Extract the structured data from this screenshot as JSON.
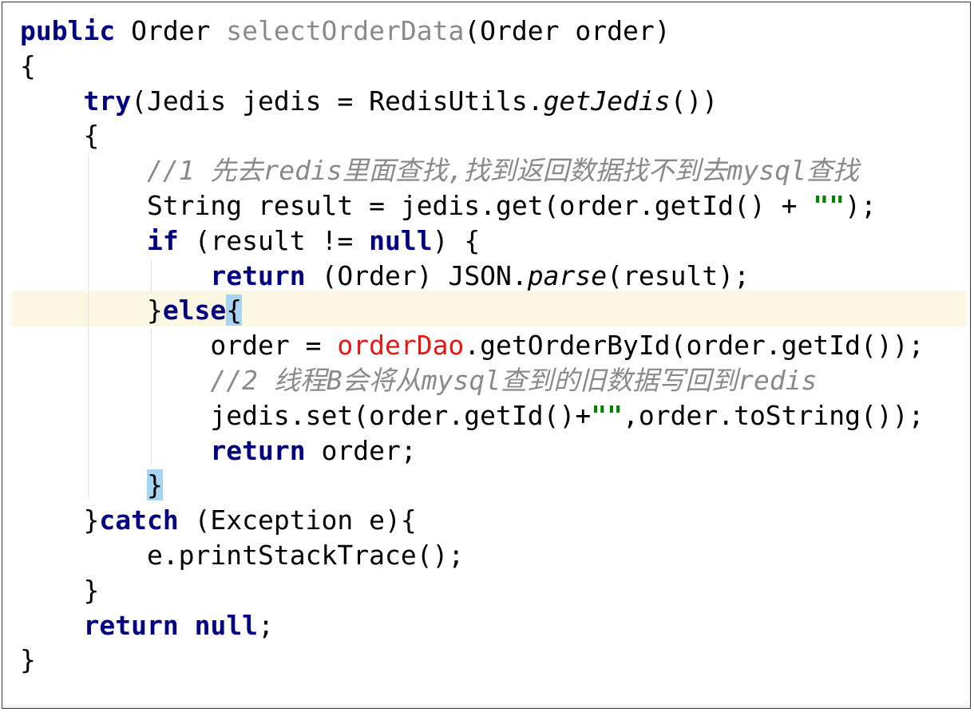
{
  "editor": {
    "lines": [
      [
        {
          "t": "public",
          "c": "kw"
        },
        {
          "t": " Order "
        },
        {
          "t": "selectOrderData",
          "c": "fn-decl"
        },
        {
          "t": "(Order order)"
        }
      ],
      [
        {
          "t": "{"
        }
      ],
      [
        {
          "t": "    "
        },
        {
          "t": "try",
          "c": "kw"
        },
        {
          "t": "(Jedis jedis = RedisUtils."
        },
        {
          "t": "getJedis",
          "c": "it"
        },
        {
          "t": "())"
        }
      ],
      [
        {
          "t": "    {"
        }
      ],
      [
        {
          "t": "        "
        },
        {
          "t": "//1 先去redis里面查找,找到返回数据找不到去mysql查找",
          "c": "cm"
        }
      ],
      [
        {
          "t": "        String result = jedis.get(order.getId() + "
        },
        {
          "t": "\"\"",
          "c": "str"
        },
        {
          "t": ");"
        }
      ],
      [
        {
          "t": "        "
        },
        {
          "t": "if",
          "c": "kw"
        },
        {
          "t": " (result != "
        },
        {
          "t": "null",
          "c": "kw"
        },
        {
          "t": ") {"
        }
      ],
      [
        {
          "t": "            "
        },
        {
          "t": "return",
          "c": "kw"
        },
        {
          "t": " (Order) JSON."
        },
        {
          "t": "parse",
          "c": "it"
        },
        {
          "t": "(result);"
        }
      ],
      [
        {
          "t": "        }"
        },
        {
          "t": "else",
          "c": "kw"
        },
        {
          "t": "{",
          "c": "brace-hl"
        }
      ],
      [
        {
          "t": "            order = "
        },
        {
          "t": "orderDao",
          "c": "field"
        },
        {
          "t": ".getOrderById(order.getId());"
        }
      ],
      [
        {
          "t": "            "
        },
        {
          "t": "//2 线程B会将从mysql查到的旧数据写回到redis",
          "c": "cm"
        }
      ],
      [
        {
          "t": "            jedis.set(order.getId()+"
        },
        {
          "t": "\"\"",
          "c": "str"
        },
        {
          "t": ",order.toString());"
        }
      ],
      [
        {
          "t": "            "
        },
        {
          "t": "return",
          "c": "kw"
        },
        {
          "t": " order;"
        }
      ],
      [
        {
          "t": "        "
        },
        {
          "t": "}",
          "c": "brace-hl"
        }
      ],
      [
        {
          "t": "    }"
        },
        {
          "t": "catch",
          "c": "kw"
        },
        {
          "t": " (Exception e){"
        }
      ],
      [
        {
          "t": "        e.printStackTrace();"
        }
      ],
      [
        {
          "t": "    }"
        }
      ],
      [
        {
          "t": "    "
        },
        {
          "t": "return",
          "c": "kw"
        },
        {
          "t": " "
        },
        {
          "t": "null",
          "c": "kw"
        },
        {
          "t": ";"
        }
      ],
      [
        {
          "t": "}"
        }
      ]
    ]
  }
}
